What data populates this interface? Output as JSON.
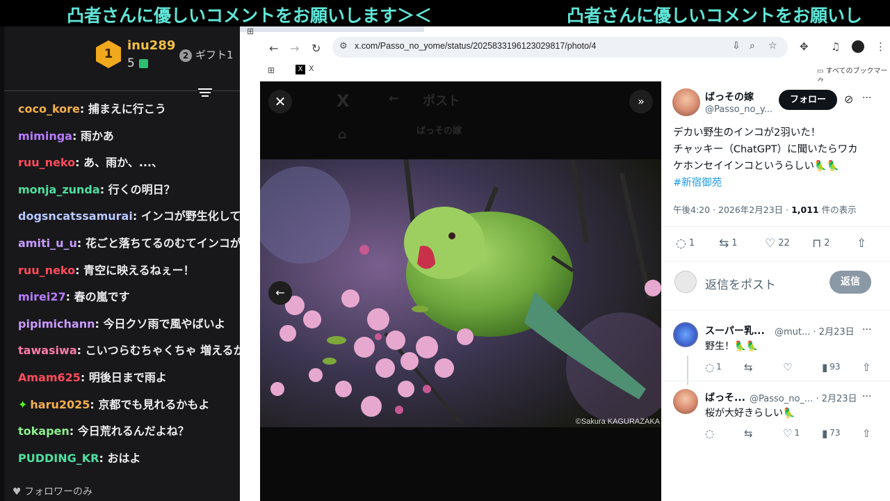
{
  "ticker": {
    "text1": "凸者さんに優しいコメントをお願いします＞＜",
    "text2": "凸者さんに優しいコメントをお願いし"
  },
  "chat": {
    "gifter": {
      "rank": "1",
      "user": "inu289",
      "count": "5"
    },
    "gift_label": "ギフト1",
    "gift_rank": "2",
    "messages": [
      {
        "user": "coco_kore",
        "color": "#f5b04a",
        "text": "捕まえに行こう"
      },
      {
        "user": "miminga",
        "color": "#b77cff",
        "text": "雨かあ"
      },
      {
        "user": "ruu_neko",
        "color": "#ff4b5a",
        "text": "あ、雨か、...、"
      },
      {
        "user": "monja_zunda",
        "color": "#4ee0a0",
        "text": "行くの明日？"
      },
      {
        "user": "dogsncatssamurai",
        "color": "#b8c7ff",
        "text": "インコが野生化して鮮"
      },
      {
        "user": "amiti_u_u",
        "color": "#c99bff",
        "text": "花ごと落ちてるのむてインコが"
      },
      {
        "user": "ruu_neko",
        "color": "#ff4b5a",
        "text": "青空に映えるねぇー！"
      },
      {
        "user": "mirei27",
        "color": "#b77cff",
        "text": "春の嵐です"
      },
      {
        "user": "pipimichann",
        "color": "#c99bff",
        "text": "今日クソ雨で風やばいよ"
      },
      {
        "user": "tawasiwa",
        "color": "#ff7aa8",
        "text": "こいつらむちゃくちゃ 増えるか"
      },
      {
        "user": "Amam625",
        "color": "#ff4b5a",
        "text": "明後日まで雨よ"
      },
      {
        "user": "haru2025",
        "color": "#f5b04a",
        "text": "京都でも見れるかもよ"
      },
      {
        "user": "tokapen",
        "color": "#8cf08c",
        "text": "今日荒れるんだよね？"
      },
      {
        "user": "PUDDING_KR",
        "color": "#4ee0a0",
        "text": "おはよ"
      }
    ],
    "footer": "フォロワーのみ"
  },
  "browser": {
    "url": "x.com/Passo_no_yome/status/2025833196123029817/photo/4",
    "bookmark_x": "X",
    "all_bookmarks": "すべてのブックマーク"
  },
  "viewer": {
    "ghost_post": "ポスト",
    "ghost_name": "ばっその嫁",
    "credit": "©Sakura KAGURAZAKA"
  },
  "post": {
    "name": "ばっその嫁",
    "handle": "@Passo_no_y...",
    "follow": "フォロー",
    "line1": "デカい野生のインコが2羽いた！",
    "line2": "チャッキー（ChatGPT）に聞いたらワカ",
    "line3": "ケホンセイインコというらしい🦜🦜",
    "hashtag": "#新宿御苑",
    "time": "午後4:20 · 2026年2月23日 · ",
    "views": "1,011",
    "views_label": " 件の表示",
    "replies": "1",
    "reposts": "1",
    "likes": "22",
    "bookmarks": "2",
    "reply_placeholder": "返信をポスト",
    "reply_button": "返信"
  },
  "replies": [
    {
      "name": "スーパー乳...",
      "handle": "@mut... · 2月23日",
      "text": "野生！🦜🦜",
      "replies": "1",
      "likes": "",
      "views": "93"
    },
    {
      "name": "ばっそ...",
      "handle": "@Passo_no_... · 2月23日",
      "text": "桜が大好きらしい🦜",
      "replies": "",
      "likes": "1",
      "views": "73"
    }
  ]
}
